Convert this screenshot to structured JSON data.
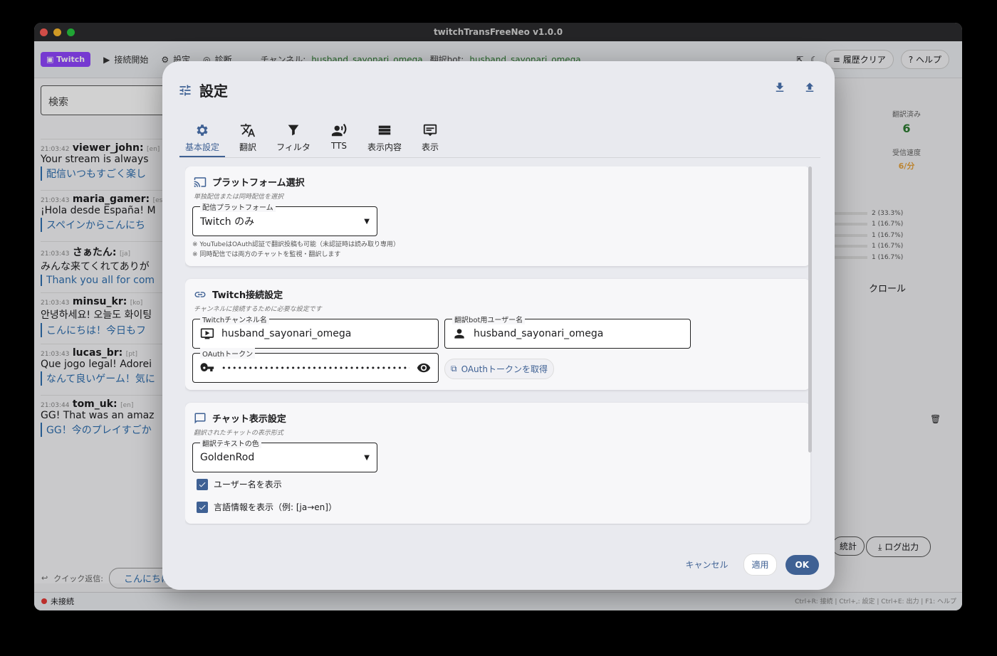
{
  "window": {
    "title": "twitchTransFreeNeo v1.0.0"
  },
  "toolbar": {
    "twitch_label": "Twitch",
    "connect_label": "接続開始",
    "settings_label": "設定",
    "diagnose_label": "診断",
    "channel_label": "チャンネル:",
    "channel_value": "husband_sayonari_omega",
    "bot_label": "翻訳bot:",
    "bot_value": "husband_sayonari_omega",
    "clear_history": "履歴クリア",
    "help": "ヘルプ"
  },
  "search": {
    "placeholder": "検索"
  },
  "chat": [
    {
      "time": "21:03:42",
      "user": "viewer_john:",
      "lang": "[en]",
      "text": "Your stream is always",
      "translation": "配信いつもすごく楽し"
    },
    {
      "time": "21:03:43",
      "user": "maria_gamer:",
      "lang": "[es]",
      "text": "¡Hola desde España! M",
      "translation": "スペインからこんにち"
    },
    {
      "time": "21:03:43",
      "user": "さぁたん:",
      "lang": "[ja]",
      "text": "みんな来てくれてありが",
      "translation": "Thank you all for com"
    },
    {
      "time": "21:03:43",
      "user": "minsu_kr:",
      "lang": "[ko]",
      "text": "안녕하세요! 오늘도 화이팅",
      "translation": "こんにちは！今日もフ"
    },
    {
      "time": "21:03:43",
      "user": "lucas_br:",
      "lang": "[pt]",
      "text": "Que jogo legal! Adorei",
      "translation": "なんて良いゲーム！気に"
    },
    {
      "time": "21:03:44",
      "user": "tom_uk:",
      "lang": "[en]",
      "text": "GG! That was an amaz",
      "translation": "GG！今のプレイすごか"
    }
  ],
  "quick_reply": {
    "label": "クイック返信:",
    "button": "こんにちは"
  },
  "status": {
    "text": "未接続",
    "shortcuts": "Ctrl+R: 接続 | Ctrl+,: 設定 | Ctrl+E: 出力 | F1: ヘルプ"
  },
  "right_panel": {
    "translated_label": "翻訳済み",
    "translated_value": "6",
    "speed_label": "受信速度",
    "speed_value": "6/分",
    "lang_stats": [
      "2 (33.3%)",
      "1 (16.7%)",
      "1 (16.7%)",
      "1 (16.7%)",
      "1 (16.7%)"
    ],
    "autoscroll_partial": "クロール",
    "stats_btn_partial": "統計",
    "log_btn": "ログ出力"
  },
  "dialog": {
    "title": "設定",
    "tabs": [
      "基本設定",
      "翻訳",
      "フィルタ",
      "TTS",
      "表示内容",
      "表示"
    ],
    "platform": {
      "title": "プラットフォーム選択",
      "subtitle": "単独配信または同時配信を選択",
      "field_label": "配信プラットフォーム",
      "value": "Twitch のみ",
      "note1": "※ YouTubeはOAuth認証で翻訳投稿も可能（未認証時は読み取り専用）",
      "note2": "※ 同時配信では両方のチャットを監視・翻訳します"
    },
    "twitch": {
      "title": "Twitch接続設定",
      "subtitle": "チャンネルに接続するために必要な設定です",
      "channel_label": "Twitchチャンネル名",
      "channel_value": "husband_sayonari_omega",
      "bot_label": "翻訳bot用ユーザー名",
      "bot_value": "husband_sayonari_omega",
      "oauth_label": "OAuthトークン",
      "oauth_value": "••••••••••••••••••••••••••••••••••••",
      "oauth_button": "OAuthトークンを取得"
    },
    "chat_display": {
      "title": "チャット表示設定",
      "subtitle": "翻訳されたチャットの表示形式",
      "color_label": "翻訳テキストの色",
      "color_value": "GoldenRod",
      "show_username": "ユーザー名を表示",
      "show_lang": "言語情報を表示（例: [ja→en]）"
    },
    "cancel": "キャンセル",
    "apply": "適用",
    "ok": "OK"
  },
  "colors": {
    "accent": "#3f6194",
    "twitch": "#9146ff",
    "translated": "#2f6fb0",
    "green": "#2e7d32"
  }
}
